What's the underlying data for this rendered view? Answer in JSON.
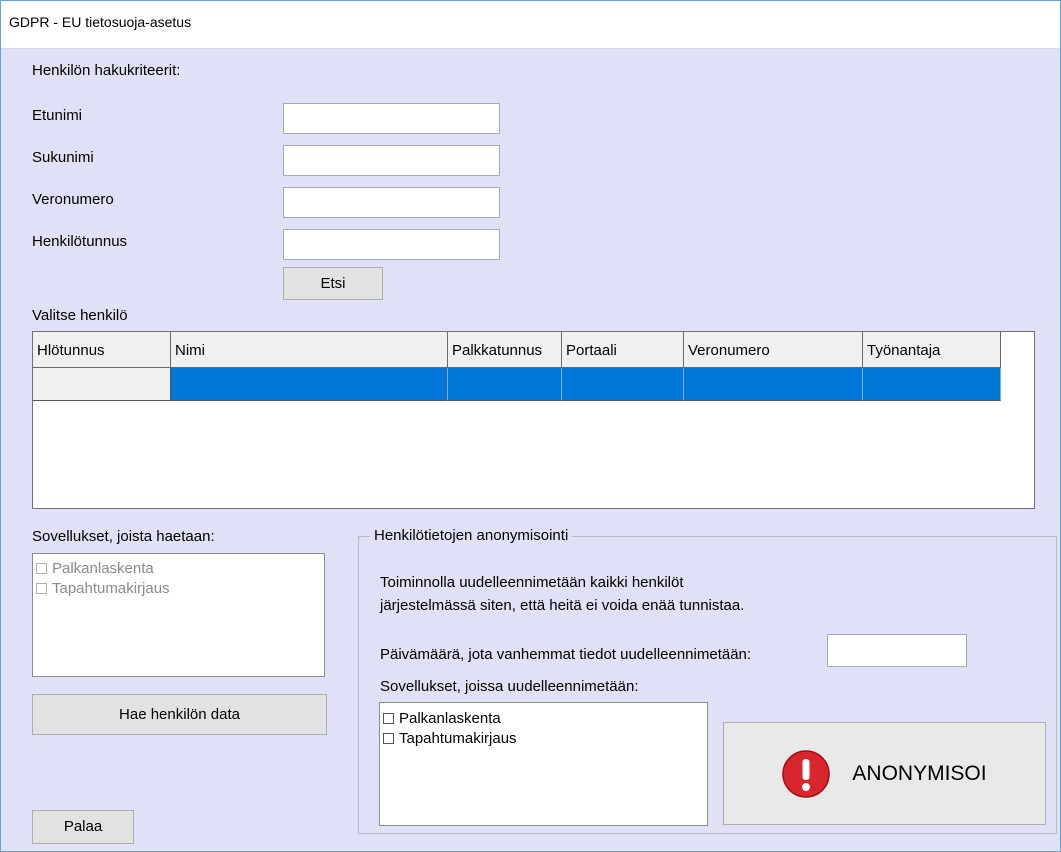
{
  "window": {
    "title": "GDPR - EU tietosuoja-asetus"
  },
  "search": {
    "heading": "Henkilön hakukriteerit:",
    "first_name_label": "Etunimi",
    "first_name_value": "",
    "last_name_label": "Sukunimi",
    "last_name_value": "",
    "tax_number_label": "Veronumero",
    "tax_number_value": "",
    "personal_id_label": "Henkilötunnus",
    "personal_id_value": "",
    "search_button": "Etsi"
  },
  "person_grid": {
    "label": "Valitse henkilö",
    "columns": [
      "Hlötunnus",
      "Nimi",
      "Palkkatunnus",
      "Portaali",
      "Veronumero",
      "Työnantaja"
    ],
    "rows": [
      [
        "",
        "",
        "",
        "",
        "",
        ""
      ]
    ],
    "selected_color": "#0078d7"
  },
  "applications": {
    "label": "Sovellukset, joista haetaan:",
    "items": [
      {
        "label": "Palkanlaskenta",
        "checked": false,
        "enabled": false
      },
      {
        "label": "Tapahtumakirjaus",
        "checked": false,
        "enabled": false
      }
    ],
    "fetch_button": "Hae henkilön data"
  },
  "anonymization": {
    "title": "Henkilötietojen anonymisointi",
    "description_line1": "Toiminnolla uudelleennimetään kaikki henkilöt",
    "description_line2": "järjestelmässä siten, että heitä ei voida enää tunnistaa.",
    "date_label": "Päivämäärä, jota vanhemmat tiedot uudelleennimetään:",
    "date_value": "",
    "apps_label": "Sovellukset, joissa uudelleennimetään:",
    "apps": [
      {
        "label": "Palkanlaskenta",
        "checked": false
      },
      {
        "label": "Tapahtumakirjaus",
        "checked": false
      }
    ],
    "anonymize_button": "ANONYMISOI",
    "warning_color": "#d9262c"
  },
  "footer": {
    "back_button": "Palaa"
  }
}
